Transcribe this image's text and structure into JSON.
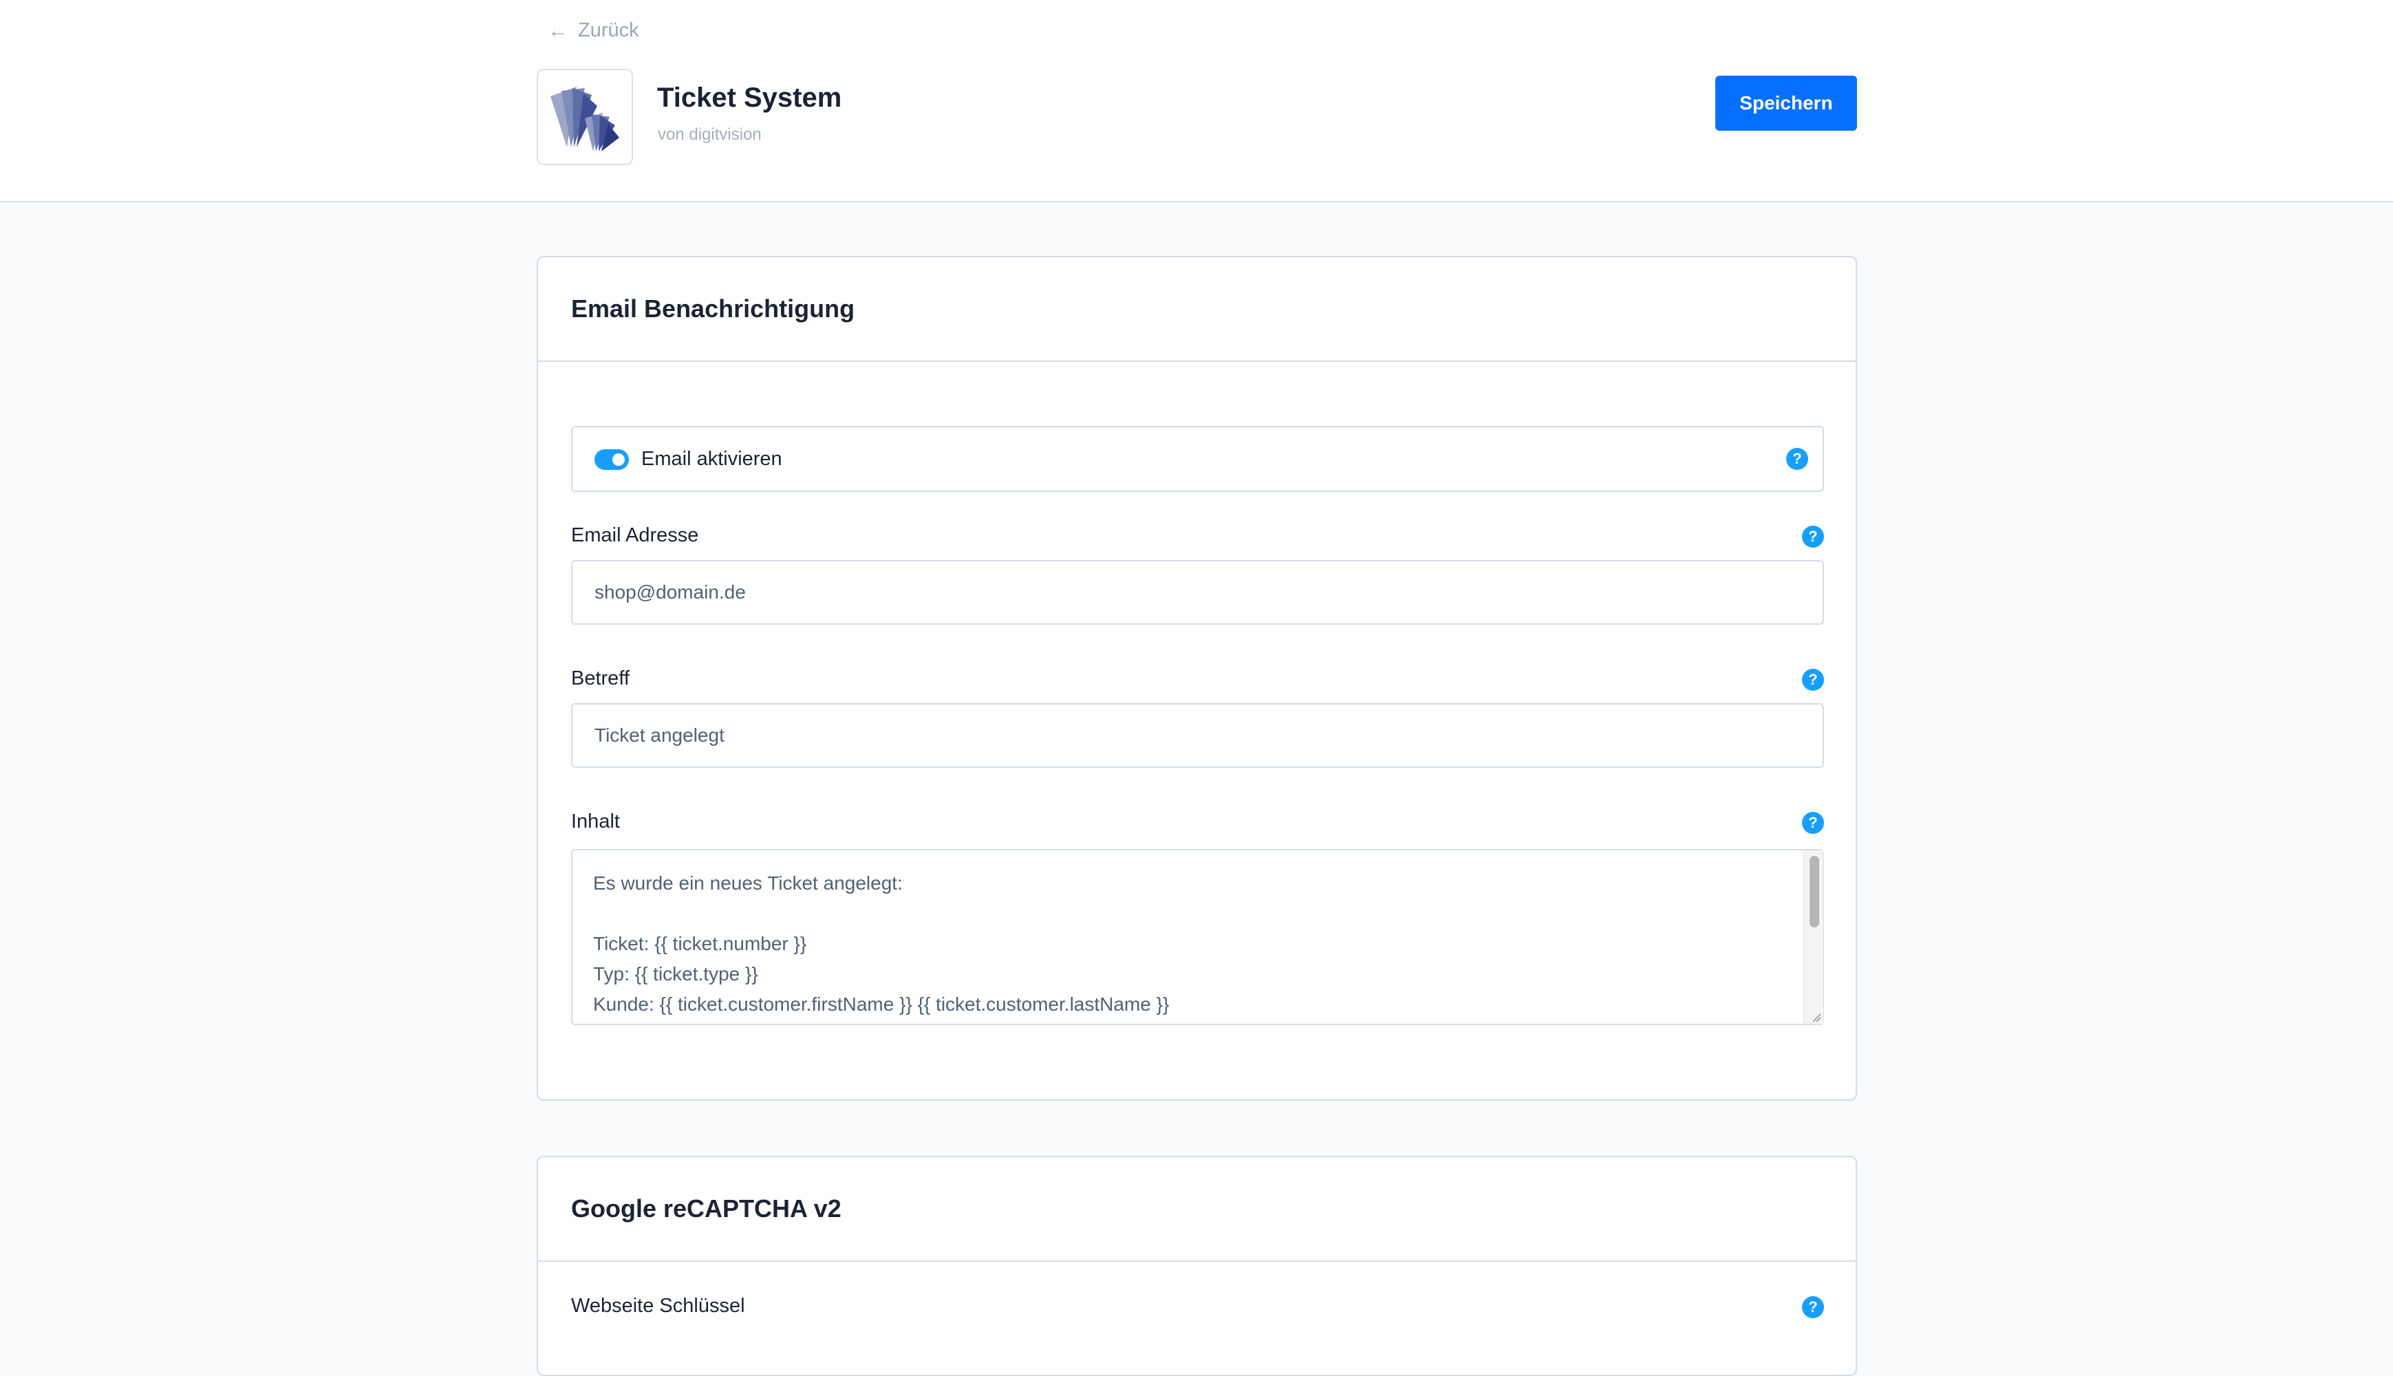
{
  "header": {
    "back_label": "Zurück",
    "app_title": "Ticket System",
    "app_subtitle": "von digitvision",
    "save_label": "Speichern"
  },
  "email_card": {
    "title": "Email Benachrichtigung",
    "toggle_label": "Email aktivieren",
    "toggle_on": true,
    "email_label": "Email Adresse",
    "email_value": "shop@domain.de",
    "subject_label": "Betreff",
    "subject_value": "Ticket angelegt",
    "content_label": "Inhalt",
    "content_value": "Es wurde ein neues Ticket angelegt:\n\nTicket: {{ ticket.number }}\nTyp: {{ ticket.type }}\nKunde: {{ ticket.customer.firstName }} {{ ticket.customer.lastName }}"
  },
  "recaptcha_card": {
    "title": "Google reCAPTCHA v2",
    "site_key_label": "Webseite Schlüssel"
  },
  "help_symbol": "?",
  "colors": {
    "primary": "#0870ff",
    "accent": "#189eff",
    "border": "#d4dce6",
    "background": "#f9fafb"
  }
}
